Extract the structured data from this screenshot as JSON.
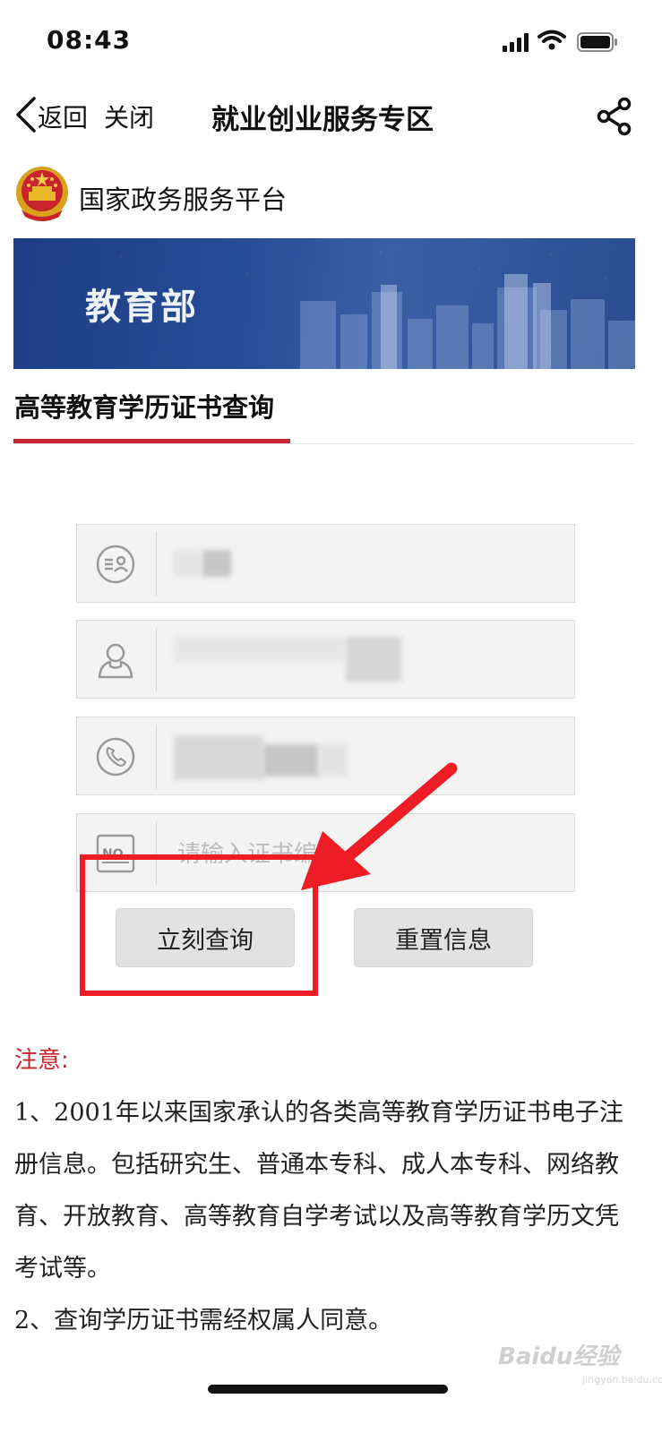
{
  "status_bar": {
    "time": "08:43"
  },
  "nav": {
    "back_label": "返回",
    "close_label": "关闭",
    "title": "就业创业服务专区"
  },
  "platform": {
    "name": "国家政务服务平台"
  },
  "banner": {
    "title": "教育部"
  },
  "section": {
    "title": "高等教育学历证书查询"
  },
  "form": {
    "certificate_number_placeholder": "请输入证书编号"
  },
  "buttons": {
    "query": "立刻查询",
    "reset": "重置信息"
  },
  "notice": {
    "heading": "注意:",
    "items": [
      "1、2001年以来国家承认的各类高等教育学历证书电子注册信息。包括研究生、普通本专科、成人本专科、网络教育、开放教育、高等教育自学考试以及高等教育学历文凭考试等。",
      "2、查询学历证书需经权属人同意。"
    ]
  },
  "watermark": {
    "brand": "Baidu经验",
    "url": "jingyan.baidu.com"
  },
  "colors": {
    "accent_red": "#c8242d",
    "annotation_red": "#ee1c24",
    "banner_blue": "#264b95"
  }
}
